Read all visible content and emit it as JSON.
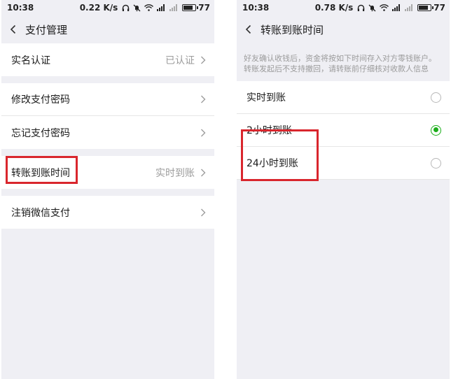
{
  "left": {
    "status": {
      "time": "10:38",
      "speed": "0.22 K/s",
      "battery": "77",
      "battery_level": 0.77
    },
    "nav": {
      "title": "支付管理"
    },
    "rows": [
      {
        "label": "实名认证",
        "value": "已认证"
      },
      {
        "label": "修改支付密码",
        "value": ""
      },
      {
        "label": "忘记支付密码",
        "value": ""
      },
      {
        "label": "转账到账时间",
        "value": "实时到账"
      },
      {
        "label": "注销微信支付",
        "value": ""
      }
    ]
  },
  "right": {
    "status": {
      "time": "10:38",
      "speed": "0.78 K/s",
      "battery": "77",
      "battery_level": 0.77
    },
    "nav": {
      "title": "转账到账时间"
    },
    "hint": "好友确认收钱后，资金将按如下时间存入对方零钱账户。转账发起后不支持撤回，请转账前仔细核对收款人信息",
    "options": [
      {
        "label": "实时到账",
        "selected": false
      },
      {
        "label": "2小时到账",
        "selected": true
      },
      {
        "label": "24小时到账",
        "selected": false
      }
    ]
  },
  "colors": {
    "accent": "#1aad19",
    "highlight": "#d9262d",
    "background": "#efeff4"
  }
}
